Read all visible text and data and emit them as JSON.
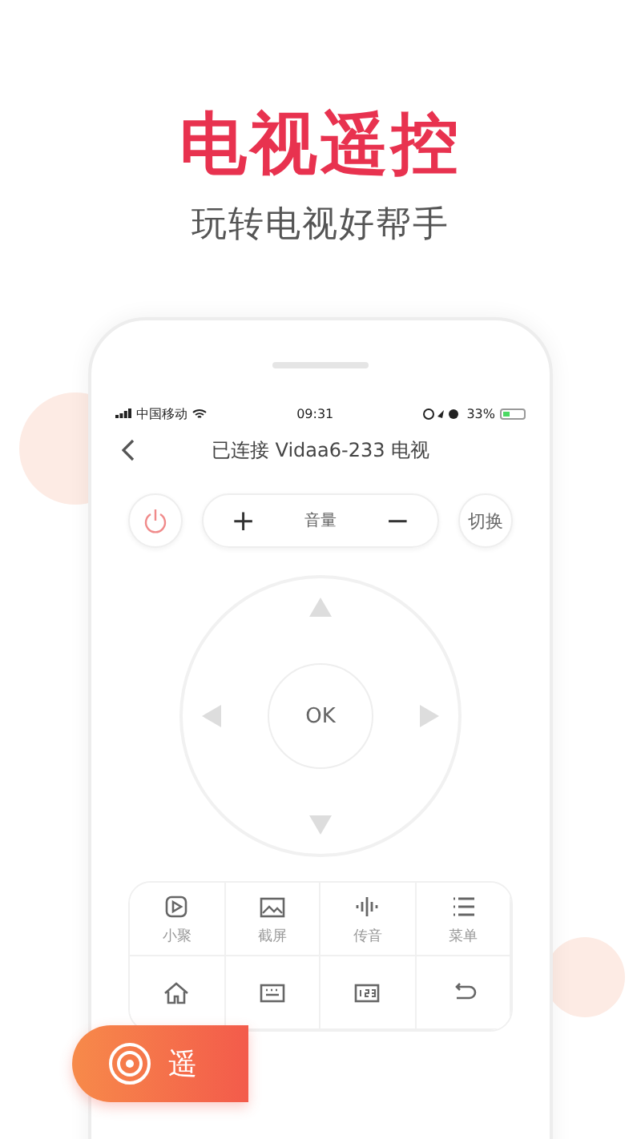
{
  "headline": "电视遥控",
  "tagline": "玩转电视好帮手",
  "status_bar": {
    "carrier": "中国移动",
    "time": "09:31",
    "battery": "33%"
  },
  "nav": {
    "title": "已连接 Vidaa6-233 电视"
  },
  "volume": {
    "plus": "+",
    "label": "音量",
    "minus": "−"
  },
  "switch_button": "切换",
  "ok_button": "OK",
  "functions": [
    {
      "kind": "cast",
      "label": "小聚"
    },
    {
      "kind": "screenshot",
      "label": "截屏"
    },
    {
      "kind": "voice",
      "label": "传音"
    },
    {
      "kind": "menu",
      "label": "菜单"
    },
    {
      "kind": "home"
    },
    {
      "kind": "keyboard"
    },
    {
      "kind": "numpad"
    },
    {
      "kind": "back"
    }
  ],
  "mode_button": {
    "label": "遥"
  }
}
